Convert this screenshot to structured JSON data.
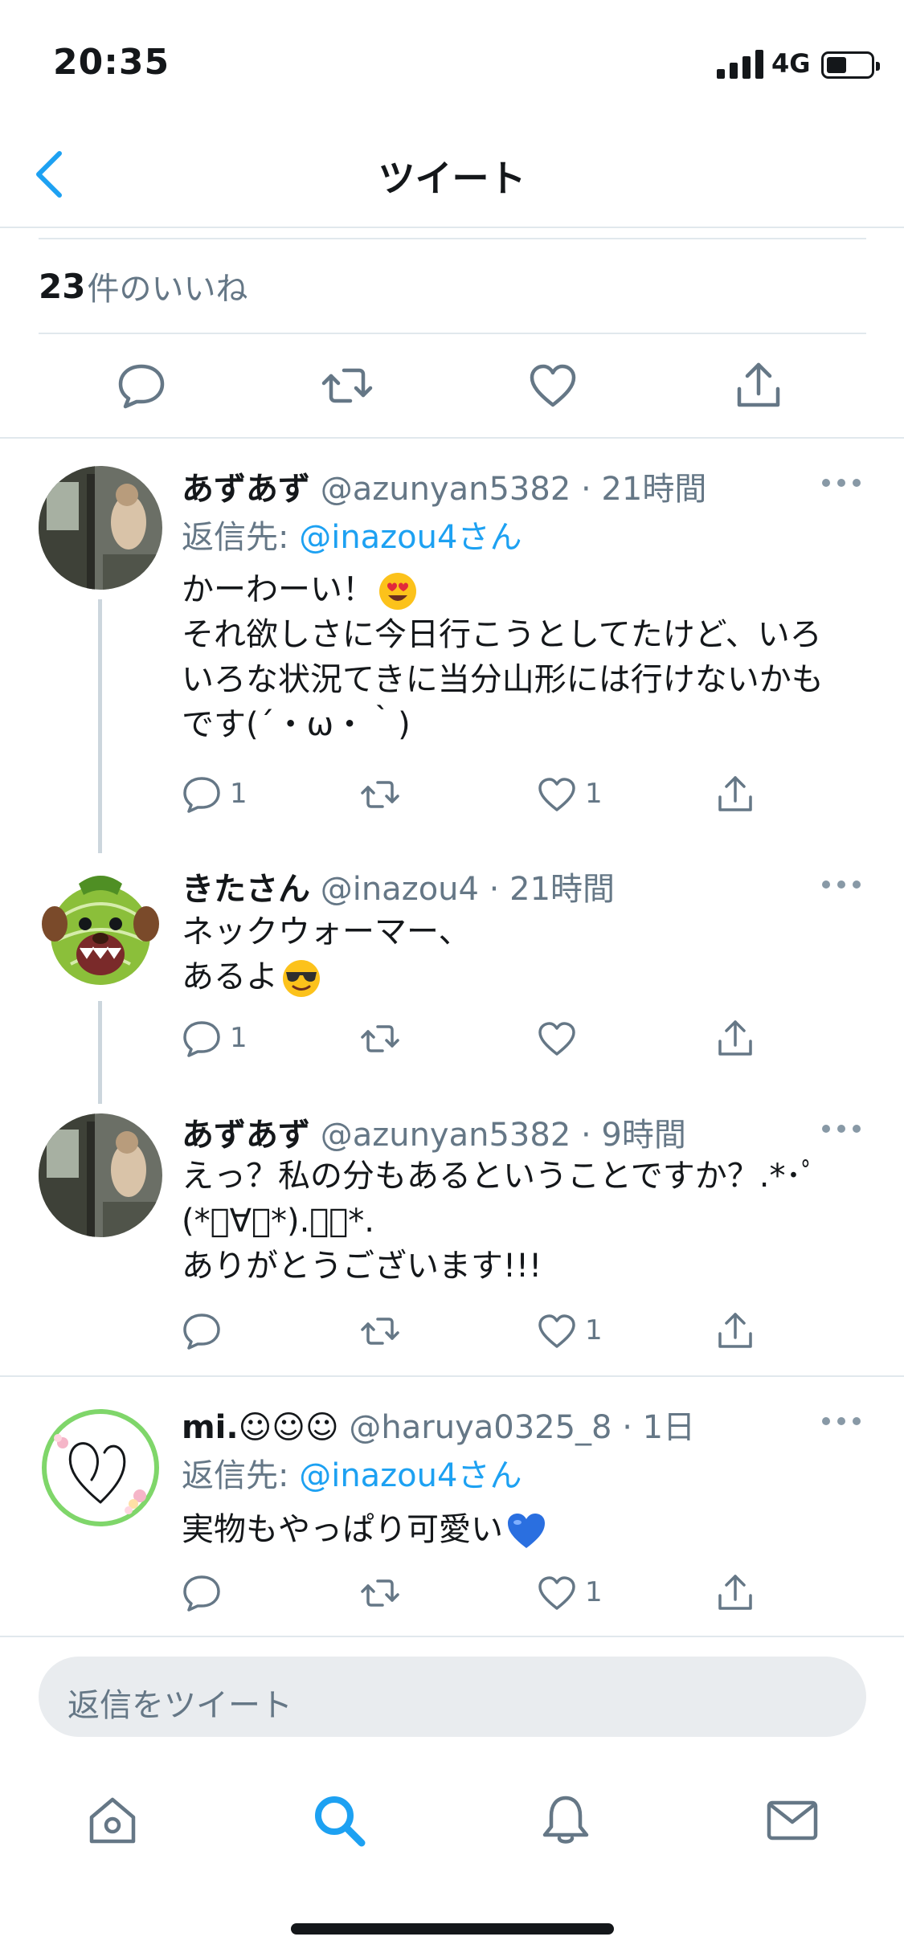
{
  "status_bar": {
    "time": "20:35",
    "network": "4G"
  },
  "header": {
    "title": "ツイート"
  },
  "likes": {
    "count": "23",
    "label": "件のいいね"
  },
  "tweets": [
    {
      "name": "あずあず",
      "handle": "@azunyan5382",
      "time": "21時間",
      "reply_prefix": "返信先: ",
      "reply_mention": "@inazou4さん",
      "lines": [
        "かーわーい！",
        "それ欲しさに今日行こうとしてたけど、いろ",
        "いろな状況てきに当分山形には行けないかも",
        "です(´・ω・｀)"
      ],
      "emoji": "heart-eyes-emoji",
      "reply_count": "1",
      "like_count": "1"
    },
    {
      "name": "きたさん",
      "handle": "@inazou4",
      "time": "21時間",
      "lines": [
        "ネックウォーマー、",
        "あるよ"
      ],
      "emoji": "sunglasses-emoji",
      "reply_count": "1",
      "like_count": ""
    },
    {
      "name": "あずあず",
      "handle": "@azunyan5382",
      "time": "9時間",
      "lines": [
        "えっ？私の分もあるということですか？.*･ﾟ",
        "(*ﾟ∀ﾟ*).ﾟ･*.",
        "ありがとうございます!!!"
      ],
      "reply_count": "",
      "like_count": "1"
    },
    {
      "name": "mi.☺☺☺",
      "handle": "@haruya0325_8",
      "time": "1日",
      "reply_prefix": "返信先: ",
      "reply_mention": "@inazou4さん",
      "lines": [
        "実物もやっぱり可愛い"
      ],
      "emoji": "blue-heart-emoji",
      "reply_count": "",
      "like_count": "1"
    }
  ],
  "reply_bar": {
    "placeholder": "返信をツイート"
  },
  "tabbar": {
    "items": [
      "home-icon",
      "search-icon",
      "notifications-icon",
      "messages-icon"
    ],
    "active": "search-icon"
  },
  "colors": {
    "accent": "#1da1f2",
    "text": "#14171a",
    "secondary": "#657786",
    "divider": "#e1e8ed"
  }
}
